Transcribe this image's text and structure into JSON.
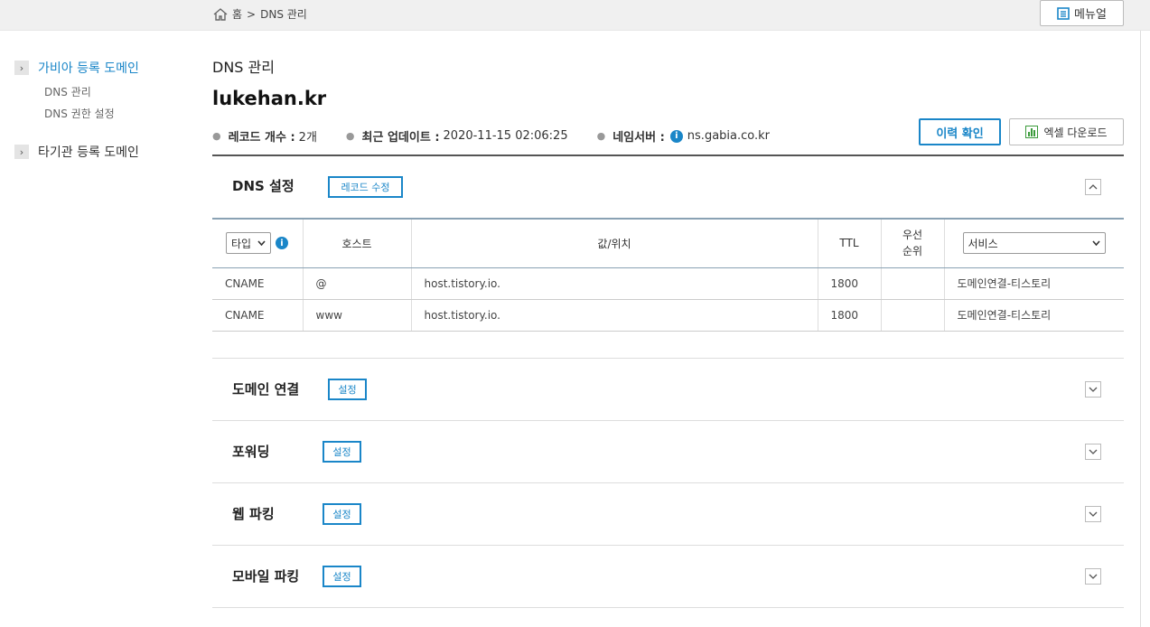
{
  "breadcrumb": {
    "home": "홈",
    "separator": ">",
    "current": "DNS 관리"
  },
  "header": {
    "manual_label": "메뉴얼"
  },
  "sidebar": {
    "groups": [
      {
        "label": "가비아 등록 도메인",
        "active": true,
        "items": [
          "DNS 관리",
          "DNS 권한 설정"
        ]
      },
      {
        "label": "타기관 등록 도메인",
        "active": false,
        "items": []
      }
    ]
  },
  "page": {
    "title": "DNS 관리",
    "domain": "lukehan.kr",
    "record_count_label": "레코드 개수 :",
    "record_count_value": "2개",
    "updated_label": "최근 업데이트 :",
    "updated_value": "2020-11-15 02:06:25",
    "nameserver_label": "네임서버 :",
    "nameserver_value": "ns.gabia.co.kr",
    "history_btn": "이력 확인",
    "excel_btn": "엑셀 다운로드"
  },
  "dns_section": {
    "title": "DNS 설정",
    "edit_btn": "레코드 수정",
    "type_select": "타입",
    "service_select": "서비스",
    "columns": {
      "host": "호스트",
      "value": "값/위치",
      "ttl": "TTL",
      "priority": "우선\n순위"
    },
    "rows": [
      {
        "type": "CNAME",
        "host": "@",
        "value": "host.tistory.io.",
        "ttl": "1800",
        "priority": "",
        "service": "도메인연결-티스토리"
      },
      {
        "type": "CNAME",
        "host": "www",
        "value": "host.tistory.io.",
        "ttl": "1800",
        "priority": "",
        "service": "도메인연결-티스토리"
      }
    ]
  },
  "sections": [
    {
      "title": "도메인 연결",
      "btn": "설정"
    },
    {
      "title": "포워딩",
      "btn": "설정"
    },
    {
      "title": "웹 파킹",
      "btn": "설정"
    },
    {
      "title": "모바일 파킹",
      "btn": "설정"
    }
  ],
  "colors": {
    "accent": "#1a86c8"
  },
  "icons": {
    "home": "home-icon",
    "manual": "document-icon",
    "info": "info-icon",
    "excel": "excel-chart-icon",
    "collapse": "chevron-up-icon",
    "expand": "chevron-down-icon",
    "side": "chevron-right-icon"
  }
}
